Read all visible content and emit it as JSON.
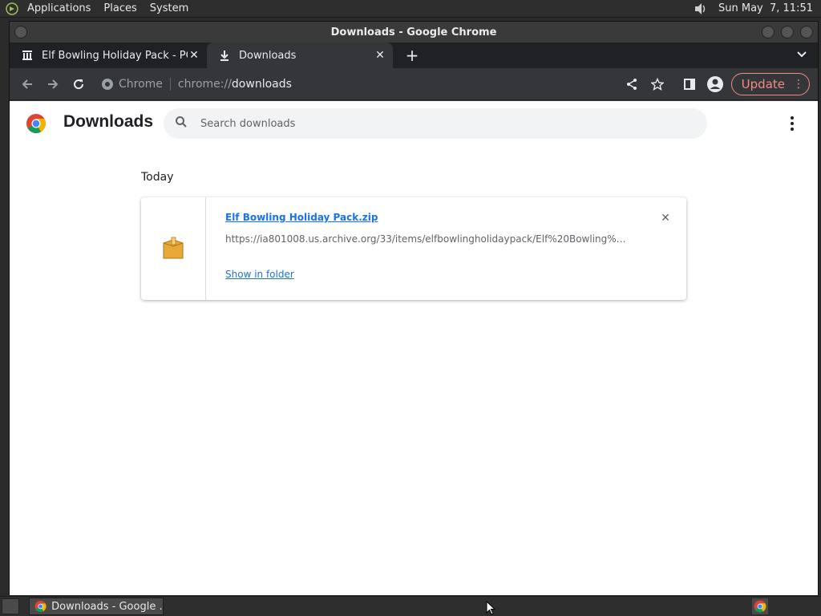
{
  "top_panel": {
    "menus": [
      "Applications",
      "Places",
      "System"
    ],
    "clock": "Sun May  7, 11:51"
  },
  "window": {
    "title": "Downloads - Google Chrome"
  },
  "tabs": [
    {
      "title": "Elf Bowling Holiday Pack - PC",
      "active": false
    },
    {
      "title": "Downloads",
      "active": true
    }
  ],
  "toolbar": {
    "chip_label": "Chrome",
    "url_scheme": "chrome://",
    "url_host": "downloads",
    "update_label": "Update"
  },
  "downloads_page": {
    "title": "Downloads",
    "search_placeholder": "Search downloads",
    "section_date": "Today",
    "items": [
      {
        "file_name": "Elf Bowling Holiday Pack.zip",
        "url": "https://ia801008.us.archive.org/33/items/elfbowlingholidaypack/Elf%20Bowling%20Holiday%20Pack.zip",
        "action": "Show in folder"
      }
    ]
  },
  "taskbar": {
    "task_label": "Downloads - Google ..."
  },
  "colors": {
    "accent_link": "#1a73e8",
    "update_red": "#f28b82",
    "chrome_dark": "#35363a"
  }
}
